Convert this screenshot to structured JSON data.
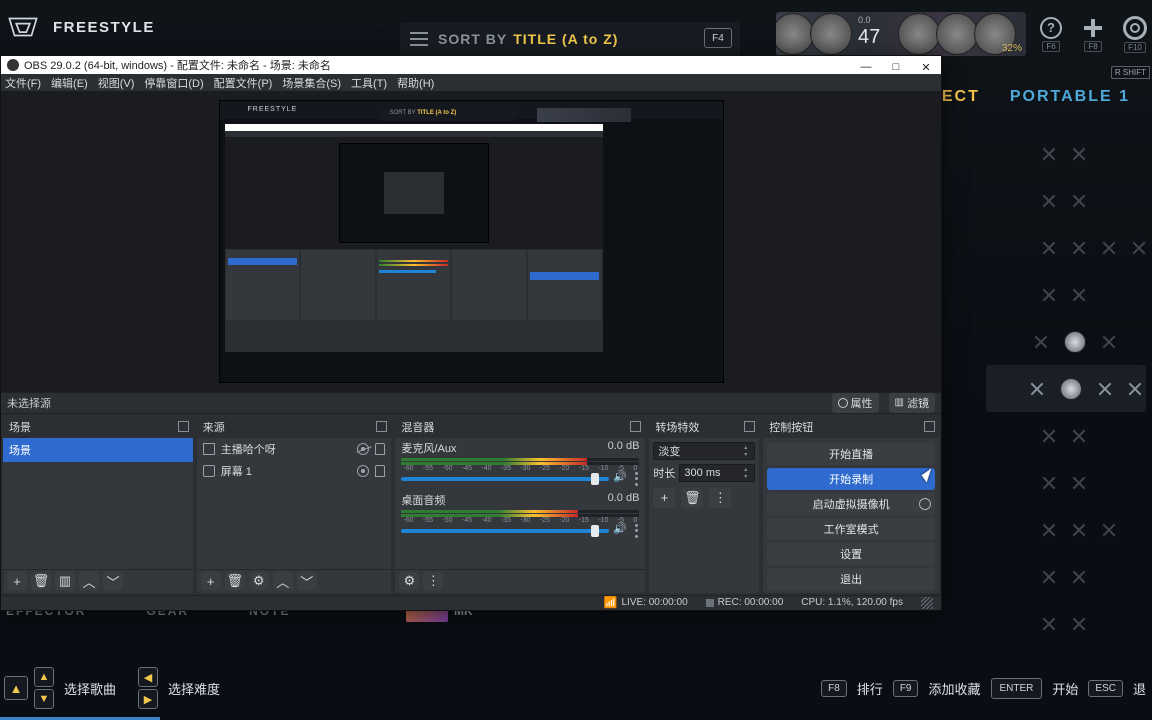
{
  "game": {
    "mode": "FREESTYLE",
    "sort": {
      "label": "SORT BY",
      "value": "TITLE (A to Z)",
      "key": "F4"
    },
    "top_icons": {
      "help_key": "F6",
      "plus_key": "F8",
      "gear_key": "F10",
      "rshift": "R SHIFT"
    },
    "profile": {
      "level_label": "0.0",
      "big_num": "47",
      "percent": "32%"
    },
    "tabs": {
      "respect": "RESPECT",
      "portable": "PORTABLE 1"
    },
    "bottom_tabs": {
      "effector": "EFFECTOR",
      "gear": "GEAR",
      "note": "NOTE",
      "mk": "MK"
    },
    "bottom": {
      "select_song": "选择歌曲",
      "select_diff": "选择难度",
      "rank_key": "F8",
      "rank": "排行",
      "fav_key": "F9",
      "fav": "添加收藏",
      "enter_key": "ENTER",
      "start": "开始",
      "esc_key": "ESC",
      "back": "退"
    }
  },
  "obs": {
    "title": "OBS 29.0.2 (64-bit, windows) - 配置文件: 未命名 - 场景: 未命名",
    "menus": [
      "文件(F)",
      "编辑(E)",
      "视图(V)",
      "停靠窗口(D)",
      "配置文件(P)",
      "场景集合(S)",
      "工具(T)",
      "帮助(H)"
    ],
    "toolbar": {
      "no_sel": "未选择源",
      "props": "属性",
      "filters": "滤镜"
    },
    "docks": {
      "scenes": {
        "title": "场景",
        "items": [
          "场景"
        ]
      },
      "sources": {
        "title": "来源",
        "items": [
          "主播哈个呀",
          "屏幕 1"
        ]
      },
      "mixer": {
        "title": "混音器",
        "channels": [
          {
            "name": "麦克风/Aux",
            "db": "0.0 dB",
            "ticks": [
              "-60",
              "-55",
              "-50",
              "-45",
              "-40",
              "-35",
              "-30",
              "-25",
              "-20",
              "-15",
              "-10",
              "-5",
              "0"
            ]
          },
          {
            "name": "桌面音频",
            "db": "0.0 dB",
            "ticks": [
              "-60",
              "-55",
              "-50",
              "-45",
              "-40",
              "-35",
              "-30",
              "-25",
              "-20",
              "-15",
              "-10",
              "-5",
              "0"
            ]
          }
        ]
      },
      "transitions": {
        "title": "转场特效",
        "selected": "淡变",
        "dur_label": "时长",
        "dur_value": "300 ms"
      },
      "controls": {
        "title": "控制按钮",
        "buttons": {
          "stream": "开始直播",
          "record": "开始录制",
          "vcam": "启动虚拟摄像机",
          "studio": "工作室模式",
          "settings": "设置",
          "exit": "退出"
        }
      }
    },
    "status": {
      "live": "LIVE: 00:00:00",
      "rec": "REC: 00:00:00",
      "cpu": "CPU: 1.1%, 120.00 fps"
    },
    "mini": {
      "sort_label": "SORT BY",
      "sort_value": "TITLE (A to Z)",
      "freestyle": "FREESTYLE"
    }
  }
}
